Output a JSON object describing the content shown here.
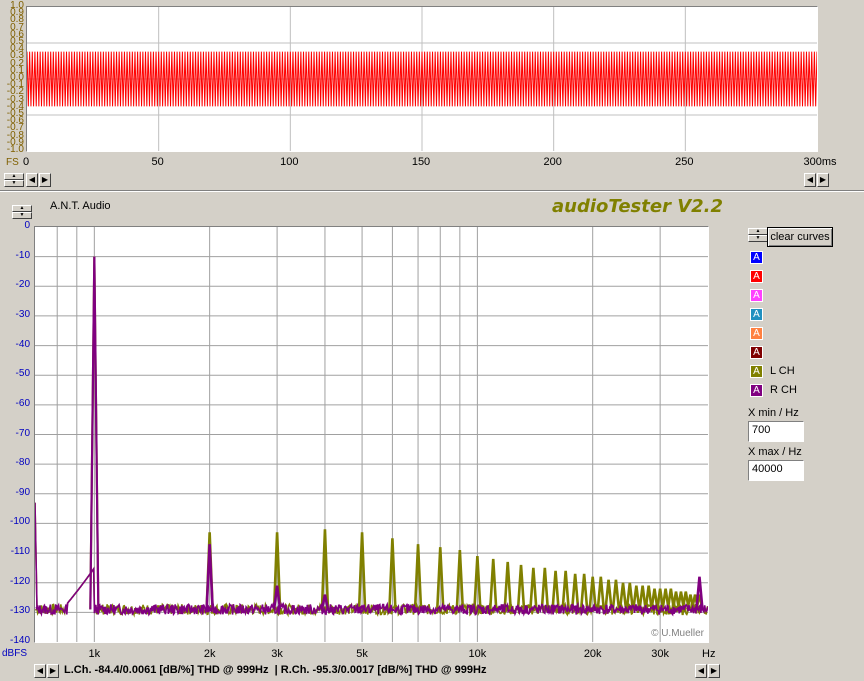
{
  "app": {
    "title": "audioTester V2.2",
    "company": "A.N.T. Audio",
    "copyright": "© U.Mueller"
  },
  "colors": {
    "left_channel": "#808000",
    "right_channel": "#800080",
    "scope_trace": "#ff0000"
  },
  "scope": {
    "y_labels": [
      "1.0",
      "0.9",
      "0.8",
      "0.7",
      "0.6",
      "0.5",
      "0.4",
      "0.3",
      "0.2",
      "0.1",
      "0.0",
      "-0.1",
      "-0.2",
      "-0.3",
      "-0.4",
      "-0.5",
      "-0.6",
      "-0.7",
      "-0.8",
      "-0.9",
      "-1.0"
    ],
    "y_labels_visible": [
      "1.0",
      "0.8",
      "0.5",
      "0.3",
      "0.0",
      "-0.3",
      "-0.5",
      "-0.8",
      "-1.0"
    ],
    "y_unit": "FS",
    "x_labels": [
      "0",
      "50",
      "100",
      "150",
      "200",
      "250",
      "300ms"
    ],
    "amplitude": 0.38
  },
  "spectrum": {
    "y_labels": [
      "0",
      "-10",
      "-20",
      "-30",
      "-40",
      "-50",
      "-60",
      "-70",
      "-80",
      "-90",
      "-100",
      "-110",
      "-120",
      "-130",
      "-140"
    ],
    "y_unit": "dBFS",
    "x_labels": [
      "1k",
      "2k",
      "3k",
      "5k",
      "10k",
      "20k",
      "30k"
    ],
    "x_unit": "Hz",
    "x_min": 700,
    "x_max": 40000,
    "y_min": -140,
    "y_max": 0
  },
  "legend": {
    "clear_label": "clear curves",
    "items": [
      {
        "color": "#0000ff",
        "glyph": "A",
        "label": ""
      },
      {
        "color": "#ff0000",
        "glyph": "A",
        "label": ""
      },
      {
        "color": "#ff40ff",
        "glyph": "A",
        "label": ""
      },
      {
        "color": "#2090c0",
        "glyph": "A",
        "label": ""
      },
      {
        "color": "#ff8040",
        "glyph": "A",
        "label": ""
      },
      {
        "color": "#800000",
        "glyph": "A",
        "label": ""
      },
      {
        "color": "#808000",
        "glyph": "A",
        "label": "L CH"
      },
      {
        "color": "#800080",
        "glyph": "A",
        "label": "R CH"
      }
    ],
    "xmin_label": "X min / Hz",
    "xmin_value": "700",
    "xmax_label": "X max / Hz",
    "xmax_value": "40000"
  },
  "status": {
    "text": "L.Ch. -84.4/0.0061 [dB/%] THD @ 999Hz  | R.Ch. -95.3/0.0017 [dB/%] THD @ 999Hz"
  },
  "chart_data": [
    {
      "type": "line",
      "title": "",
      "xlabel": "ms",
      "ylabel": "FS",
      "xlim": [
        0,
        300
      ],
      "ylim": [
        -1.0,
        1.0
      ],
      "grid": true,
      "series": [
        {
          "name": "",
          "description_values": "1 kHz sine, amplitude about ±0.38 FS",
          "values": [
            0.38,
            -0.38
          ]
        }
      ]
    },
    {
      "type": "line",
      "title": "",
      "xlabel": "Hz",
      "ylabel": "dBFS",
      "xscale": "log",
      "xlim": [
        700,
        40000
      ],
      "ylim": [
        -140,
        0
      ],
      "grid": true,
      "noise_floor": -129,
      "series": [
        {
          "name": "L CH",
          "x": [
            1000,
            2000,
            3000,
            4000,
            5000,
            6000,
            7000,
            8000,
            9000,
            10000,
            11000,
            12000,
            13000,
            14000,
            15000,
            16000,
            17000,
            18000,
            19000,
            20000,
            21000,
            22000,
            23000,
            24000,
            25000,
            26000,
            27000,
            28000,
            29000,
            30000,
            31000,
            32000,
            33000,
            34000,
            35000,
            36000,
            37000,
            38000
          ],
          "values": [
            -10,
            -103,
            -103,
            -102,
            -103,
            -105,
            -107,
            -108,
            -109,
            -111,
            -112,
            -113,
            -114,
            -115,
            -115,
            -116,
            -116,
            -117,
            -117,
            -118,
            -118,
            -119,
            -119,
            -120,
            -120,
            -121,
            -121,
            -121,
            -122,
            -122,
            -122,
            -122,
            -123,
            -123,
            -123,
            -124,
            -124,
            -124
          ]
        },
        {
          "name": "R CH",
          "x": [
            1000,
            2000,
            3000,
            4000,
            5000,
            38000
          ],
          "values": [
            -10,
            -107,
            -121,
            -124,
            -128,
            -118
          ]
        }
      ]
    }
  ]
}
